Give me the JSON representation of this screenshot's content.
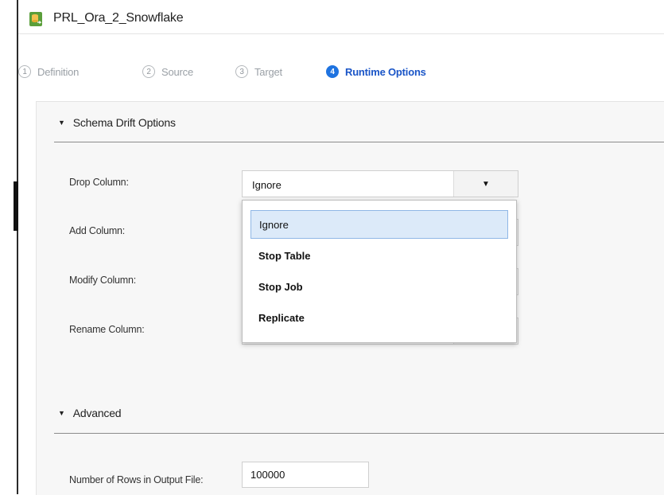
{
  "window": {
    "title": "PRL_Ora_2_Snowflake",
    "icon": "database-task-icon"
  },
  "steps": [
    {
      "num": "1",
      "label": "Definition",
      "active": false
    },
    {
      "num": "2",
      "label": "Source",
      "active": false
    },
    {
      "num": "3",
      "label": "Target",
      "active": false
    },
    {
      "num": "4",
      "label": "Runtime Options",
      "active": true
    }
  ],
  "schema_drift": {
    "header": "Schema Drift Options",
    "fields": [
      {
        "label": "Drop Column:",
        "value": "Ignore"
      },
      {
        "label": "Add Column:",
        "value": ""
      },
      {
        "label": "Modify Column:",
        "value": ""
      },
      {
        "label": "Rename Column:",
        "value": ""
      }
    ],
    "dropdown_options": [
      {
        "label": "Ignore",
        "selected": true
      },
      {
        "label": "Stop Table",
        "selected": false
      },
      {
        "label": "Stop Job",
        "selected": false
      },
      {
        "label": "Replicate",
        "selected": false
      }
    ]
  },
  "advanced": {
    "header": "Advanced",
    "rows_label": "Number of Rows in Output File:",
    "rows_value": "100000"
  },
  "colors": {
    "accent": "#1f73e0",
    "active_step_text": "#1a55c7",
    "selected_option_bg": "#dceaf9"
  }
}
